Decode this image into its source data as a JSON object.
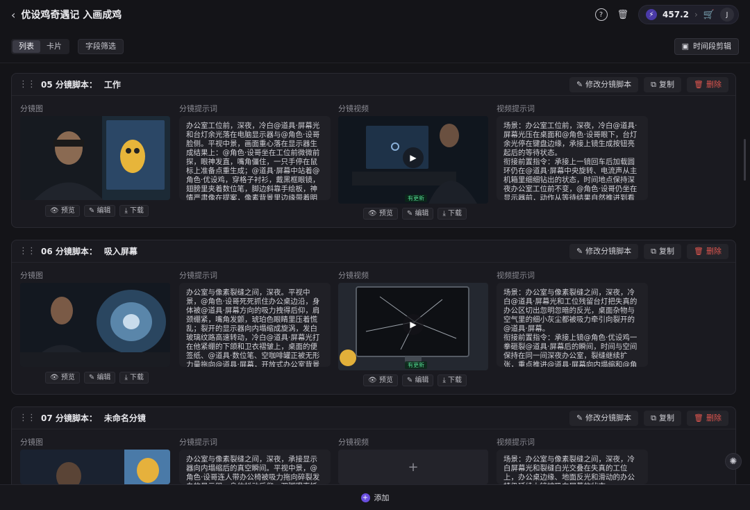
{
  "header": {
    "back_icon": "chevron-left-icon",
    "title": "优设鸡奇遇记 入画成鸡",
    "credits": "457.2",
    "avatar_initial": "J"
  },
  "toolbar": {
    "view_list": "列表",
    "view_card": "卡片",
    "field_filter": "字段筛选",
    "time_edit": "时间段剪辑"
  },
  "labels": {
    "storyboard_image": "分镜图",
    "storyboard_prompt": "分镜提示词",
    "storyboard_video": "分镜视频",
    "video_prompt": "视频提示词",
    "preview": "预览",
    "edit": "编辑",
    "download": "下载",
    "edit_script": "修改分镜脚本",
    "copy": "复制",
    "delete": "删除",
    "updated_badge": "有更新"
  },
  "scenes": [
    {
      "number": "05 分镜脚本：",
      "name": "工作",
      "image_prompt": "办公室工位前，深夜，冷白@道具·屏幕光和台灯余光落在电脑显示器与@角色·设哥脸侧。平视中景，画面重心落在显示器生成结果上：@角色·设哥坐在工位前微微前探，眼神发直，嘴角僵住，一只手停在鼠标上准备点重生成；@道具·屏幕中站着@角色·优设鸡，穿格子衬衫，戴黑框眼镜，翅膀里夹着数位笔，脚边斜靠手绘板，神情严肃像在提案，像素背景里边缘带着明显错位",
      "video_prompt": "场景：办公室工位前，深夜，冷白@道具·屏幕光压在桌面和@角色·设哥眼下，台灯余光停在键盘边缘，承接上镜生成按钮亮起后的等待状态。\n衔接前置指令：承接上一镜回车后加载圆环仍在@道具·屏幕中央旋转、电流声从主机箱里细细钻出的状态，时间地点保持深夜办公室工位前不变，@角色·设哥仍坐在显示器前，动作从等待结果自然推进到看清生成",
      "has_video": true
    },
    {
      "number": "06 分镜脚本：",
      "name": "吸入屏幕",
      "image_prompt": "办公室与像素裂缝之间，深夜。平视中景，@角色·设哥死死抓住办公桌边沿，身体被@道具·屏幕方向的吸力拽得后仰，肩颈绷紧，嘴角发颤，琥珀色眼睛里压着慌乱；裂开的显示器向内塌缩成旋涡，发白玻璃纹路高速转动，冷白@道具·屏幕光打在他紧绷的下颌和卫衣褶皱上，桌面的便签纸、@道具·数位笔、空咖啡罐正被无形力量拖向@道具·屏幕，开放式办公室背景开始轻微拉",
      "video_prompt": "场景：办公室与像素裂缝之间，深夜，冷白@道具·屏幕光和工位残留台灯把失真的办公区切出忽明忽暗的反光，桌面杂物与空气里的细小灰尘都被吸力牵引向裂开的@道具·屏幕。\n衔接前置指令：承接上镜@角色·优设鸡一拳砸裂@道具·屏幕后的瞬间，时间与空间保持在同一间深夜办公室，裂缝继续扩张，重点推进@道具·屏幕向内塌缩和@角色·设",
      "has_video": true
    },
    {
      "number": "07 分镜脚本：",
      "name": "未命名分镜",
      "image_prompt": "办公室与像素裂缝之间，深夜，承接显示器向内塌缩后的真空瞬间。平视中景，@角色·设哥连人带办公椅被吸力拖向碎裂发白的显示器，身体抖动后仰，双脚蹬直抵地，近",
      "video_prompt": "场景：办公室与像素裂缝之间，深夜，冷白屏幕光和裂缝白光交叠在失真的工位上，办公桌边缘、地面反光和滑动的办公椅仍延续上镜被吸向屏幕的状态",
      "has_video": false
    }
  ],
  "bottom": {
    "add_label": "添加"
  }
}
